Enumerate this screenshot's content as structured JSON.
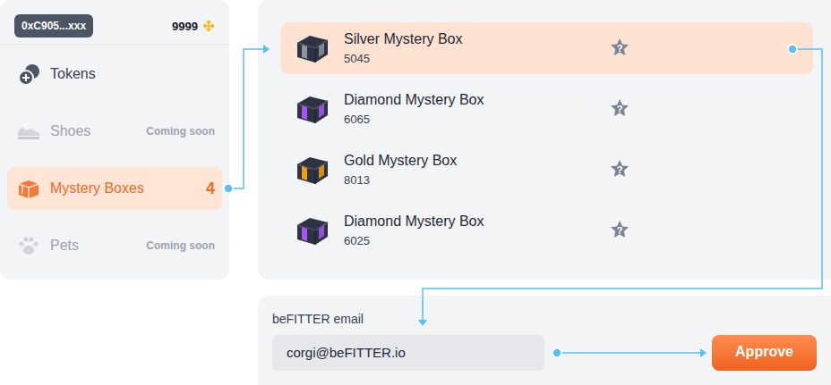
{
  "wallet": {
    "address": "0xC905...xxx",
    "balance": "9999"
  },
  "sidebar": {
    "items": [
      {
        "label": "Tokens",
        "selected": false,
        "disabled": false
      },
      {
        "label": "Shoes",
        "note": "Coming soon",
        "selected": false,
        "disabled": true
      },
      {
        "label": "Mystery Boxes",
        "count": "4",
        "selected": true,
        "disabled": false
      },
      {
        "label": "Pets",
        "note": "Coming soon",
        "selected": false,
        "disabled": true
      }
    ]
  },
  "boxes": [
    {
      "name": "Silver Mystery Box",
      "id": "5045",
      "hint": "?",
      "selected": true,
      "color": "#8b93a7"
    },
    {
      "name": "Diamond Mystery Box",
      "id": "6065",
      "hint": "?",
      "selected": false,
      "color": "#a855f7"
    },
    {
      "name": "Gold Mystery Box",
      "id": "8013",
      "hint": "?",
      "selected": false,
      "color": "#f59e0b"
    },
    {
      "name": "Diamond Mystery Box",
      "id": "6025",
      "hint": "?",
      "selected": false,
      "color": "#a855f7"
    }
  ],
  "email": {
    "label": "beFITTER email",
    "value": "corgi@beFITTER.io"
  },
  "buttons": [
    "Approve"
  ]
}
